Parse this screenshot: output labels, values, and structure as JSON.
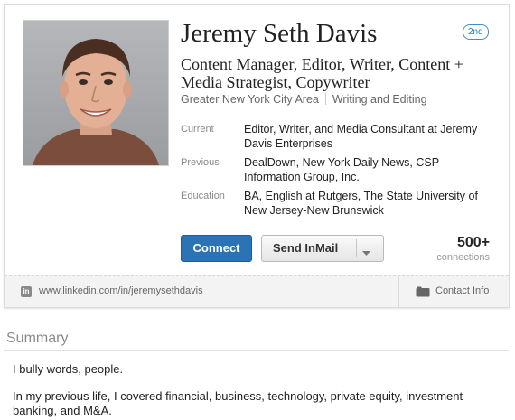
{
  "profile": {
    "name": "Jeremy Seth Davis",
    "degree": "2nd",
    "headline": "Content Manager, Editor, Writer, Content + Media Strategist, Copywriter",
    "location": "Greater New York City Area",
    "industry": "Writing and Editing"
  },
  "details": {
    "current_label": "Current",
    "current_value": "Editor, Writer, and Media Consultant at Jeremy Davis Enterprises",
    "previous_label": "Previous",
    "previous_value": "DealDown, New York Daily News, CSP Information Group, Inc.",
    "education_label": "Education",
    "education_value": "BA, English at Rutgers, The State University of New Jersey-New Brunswick"
  },
  "actions": {
    "connect_label": "Connect",
    "inmail_label": "Send InMail"
  },
  "connections": {
    "count": "500+",
    "label": "connections"
  },
  "footer": {
    "linkedin_icon": "in",
    "url": "www.linkedin.com/in/jeremysethdavis",
    "contact_label": "Contact Info"
  },
  "summary": {
    "title": "Summary",
    "paragraph1": "I bully words, people.",
    "paragraph2": "In my previous life, I covered financial, business, technology, private equity, investment banking, and M&A."
  },
  "colors": {
    "accent": "#2a73b6",
    "degree_badge": "#3a8fc7"
  },
  "icons": {
    "linkedin": "linkedin-icon",
    "contact": "address-book-icon",
    "dropdown": "chevron-down-icon"
  }
}
